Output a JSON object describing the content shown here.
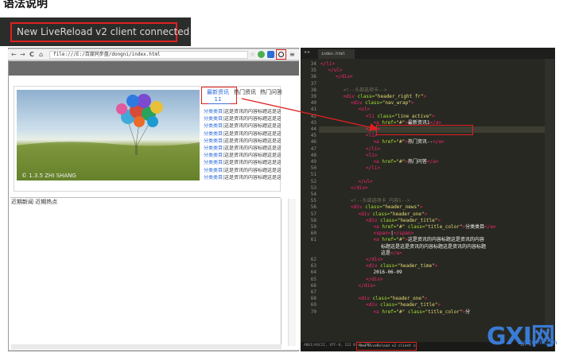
{
  "banner": {
    "heading": "语法说明",
    "toast": "New LiveReload v2 client connected"
  },
  "browser": {
    "back": "←",
    "forward": "→",
    "reload": "C",
    "home": "⌂",
    "url": "file:///E:/百度同步盘/dongni/index.html",
    "hero_caption": "© 1.3.5 ZHI SHANG",
    "tabs": [
      "最新资讯",
      "热门资讯",
      "热门问答"
    ],
    "active_tab_sub": "11",
    "news_items": [
      {
        "cat": "分类类目",
        "text": "这是资讯的内容标题这是这是资讯"
      },
      {
        "cat": "分类类目",
        "text": "这是资讯的内容标题这是这是资讯"
      },
      {
        "cat": "分类类目",
        "text": "这是资讯的内容标题这是这是资讯"
      },
      {
        "cat": "分类类目",
        "text": "这是资讯的内容标题这是这是资讯"
      },
      {
        "cat": "分类类目",
        "text": "这是资讯的内容标题这是这是资讯"
      },
      {
        "cat": "分类类目",
        "text": "这是资讯的内容标题这是这是资讯"
      },
      {
        "cat": "分类类目",
        "text": "这是资讯的内容标题这是这是资讯"
      },
      {
        "cat": "分类类目",
        "text": "这是资讯的内容标题这是这是资讯"
      },
      {
        "cat": "分类类目",
        "text": "这是资讯的内容标题这是这是资讯"
      },
      {
        "cat": "分类类目",
        "text": "这是资讯的内容标题这是这是资讯"
      }
    ],
    "news_sep": "|",
    "bottom_text": "近期新闻 近期热点"
  },
  "editor": {
    "tab": "index.html",
    "lines": [
      {
        "n": "34",
        "x": 0,
        "h": [
          [
            "t",
            "</li>"
          ]
        ]
      },
      {
        "n": "35",
        "x": 1,
        "h": [
          [
            "t",
            "</ul>"
          ]
        ]
      },
      {
        "n": "36",
        "x": 2,
        "h": [
          [
            "t",
            "</div>"
          ]
        ]
      },
      {
        "n": "37",
        "x": 0,
        "h": []
      },
      {
        "n": "38",
        "x": 3,
        "h": [
          [
            "c",
            "<!--头部选项卡-->"
          ]
        ]
      },
      {
        "n": "39",
        "x": 3,
        "h": [
          [
            "t",
            "<div "
          ],
          [
            "a",
            "class="
          ],
          [
            "s",
            "\"header_right fr\""
          ],
          [
            "t",
            ">"
          ]
        ]
      },
      {
        "n": "40",
        "x": 4,
        "h": [
          [
            "t",
            "<div "
          ],
          [
            "a",
            "class="
          ],
          [
            "s",
            "\"nav_wrap\""
          ],
          [
            "t",
            ">"
          ]
        ]
      },
      {
        "n": "41",
        "x": 5,
        "h": [
          [
            "t",
            "<ul>"
          ]
        ]
      },
      {
        "n": "42",
        "x": 6,
        "h": [
          [
            "t",
            "<li "
          ],
          [
            "a",
            "class="
          ],
          [
            "s",
            "\"line active\""
          ],
          [
            "t",
            ">"
          ]
        ]
      },
      {
        "n": "43",
        "x": 7,
        "h": [
          [
            "t",
            "<a "
          ],
          [
            "a",
            "href="
          ],
          [
            "s",
            "\"#\""
          ],
          [
            "t",
            ">"
          ],
          [
            "p",
            "最新资讯1"
          ],
          [
            "t",
            "</a>"
          ]
        ]
      },
      {
        "n": "44",
        "x": 6,
        "h": [
          [
            "t",
            "</li>"
          ]
        ]
      },
      {
        "n": "45",
        "x": 6,
        "h": [
          [
            "t",
            "<li>"
          ]
        ]
      },
      {
        "n": "46",
        "x": 7,
        "h": [
          [
            "t",
            "<a "
          ],
          [
            "a",
            "href="
          ],
          [
            "s",
            "\"#\""
          ],
          [
            "t",
            ">"
          ],
          [
            "p",
            "热门资讯--"
          ],
          [
            "t",
            "</a>"
          ]
        ]
      },
      {
        "n": "47",
        "x": 6,
        "h": [
          [
            "t",
            "</li>"
          ]
        ]
      },
      {
        "n": "48",
        "x": 6,
        "h": [
          [
            "t",
            "<li>"
          ]
        ]
      },
      {
        "n": "49",
        "x": 7,
        "h": [
          [
            "t",
            "<a "
          ],
          [
            "a",
            "href="
          ],
          [
            "s",
            "\"#\""
          ],
          [
            "t",
            ">"
          ],
          [
            "p",
            "热门问答"
          ],
          [
            "t",
            "</a>"
          ]
        ]
      },
      {
        "n": "50",
        "x": 6,
        "h": [
          [
            "t",
            "</li>"
          ]
        ]
      },
      {
        "n": "51",
        "x": 0,
        "h": []
      },
      {
        "n": "52",
        "x": 5,
        "h": [
          [
            "t",
            "</ul>"
          ]
        ]
      },
      {
        "n": "53",
        "x": 4,
        "h": [
          [
            "t",
            "</div>"
          ]
        ]
      },
      {
        "n": "54",
        "x": 0,
        "h": []
      },
      {
        "n": "55",
        "x": 4,
        "h": [
          [
            "c",
            "<!--头部选项卡_内容1-->"
          ]
        ]
      },
      {
        "n": "56",
        "x": 4,
        "h": [
          [
            "t",
            "<div "
          ],
          [
            "a",
            "class="
          ],
          [
            "s",
            "\"header_news\""
          ],
          [
            "t",
            ">"
          ]
        ]
      },
      {
        "n": "57",
        "x": 5,
        "h": [
          [
            "t",
            "<div "
          ],
          [
            "a",
            "class="
          ],
          [
            "s",
            "\"header_one\""
          ],
          [
            "t",
            ">"
          ]
        ]
      },
      {
        "n": "58",
        "x": 6,
        "h": [
          [
            "t",
            "<div "
          ],
          [
            "a",
            "class="
          ],
          [
            "s",
            "\"header_title\""
          ],
          [
            "t",
            ">"
          ]
        ]
      },
      {
        "n": "59",
        "x": 7,
        "h": [
          [
            "t",
            "<a "
          ],
          [
            "a",
            "href="
          ],
          [
            "s",
            "\"#\" "
          ],
          [
            "a",
            "class="
          ],
          [
            "s",
            "\"title_color\""
          ],
          [
            "t",
            ">"
          ],
          [
            "p",
            "分类类目"
          ],
          [
            "t",
            "</a>"
          ]
        ]
      },
      {
        "n": "60",
        "x": 7,
        "h": [
          [
            "t",
            "<span>"
          ],
          [
            "p",
            "|"
          ],
          [
            "t",
            "</span>"
          ]
        ]
      },
      {
        "n": "61",
        "x": 7,
        "h": [
          [
            "t",
            "<a "
          ],
          [
            "a",
            "href="
          ],
          [
            "s",
            "\"#\""
          ],
          [
            "t",
            ">"
          ],
          [
            "p",
            "这是资讯的内容标题这是资讯的内容"
          ]
        ]
      },
      {
        "n": "",
        "x": 8,
        "h": [
          [
            "p",
            "标题这是这是资讯的内容标题这是资讯的内容标题"
          ]
        ]
      },
      {
        "n": "",
        "x": 8,
        "h": [
          [
            "p",
            "这是"
          ],
          [
            "t",
            "</a>"
          ]
        ]
      },
      {
        "n": "62",
        "x": 6,
        "h": [
          [
            "t",
            "</div>"
          ]
        ]
      },
      {
        "n": "63",
        "x": 6,
        "h": [
          [
            "t",
            "<div "
          ],
          [
            "a",
            "class="
          ],
          [
            "s",
            "\"header_time\""
          ],
          [
            "t",
            ">"
          ]
        ]
      },
      {
        "n": "64",
        "x": 7,
        "h": [
          [
            "p",
            "2016-06-09"
          ]
        ]
      },
      {
        "n": "65",
        "x": 6,
        "h": [
          [
            "t",
            "</div>"
          ]
        ]
      },
      {
        "n": "66",
        "x": 5,
        "h": [
          [
            "t",
            "</div>"
          ]
        ]
      },
      {
        "n": "67",
        "x": 0,
        "h": []
      },
      {
        "n": "68",
        "x": 5,
        "h": [
          [
            "t",
            "<div "
          ],
          [
            "a",
            "class="
          ],
          [
            "s",
            "\"header_one\""
          ],
          [
            "t",
            ">"
          ]
        ]
      },
      {
        "n": "69",
        "x": 6,
        "h": [
          [
            "t",
            "<div "
          ],
          [
            "a",
            "class="
          ],
          [
            "s",
            "\"header_title\""
          ],
          [
            "t",
            ">"
          ]
        ]
      },
      {
        "n": "70",
        "x": 7,
        "h": [
          [
            "t",
            "<a "
          ],
          [
            "a",
            "href="
          ],
          [
            "s",
            "\"#\" "
          ],
          [
            "a",
            "class="
          ],
          [
            "s",
            "\"title_color\""
          ],
          [
            "t",
            ">"
          ],
          [
            "p",
            "分"
          ]
        ]
      }
    ],
    "status_left": "ANSI/ASCII, UTF-8, 112 B(s) 100",
    "status_toast": "New LiveReload v2 client connected",
    "status_right": "UTF-8"
  },
  "watermark": {
    "big": "GXI网",
    "small": "system.com"
  },
  "colors": {
    "annotation_red": "#e02020",
    "editor_bg": "#272822",
    "link_blue": "#2a6ad8"
  }
}
